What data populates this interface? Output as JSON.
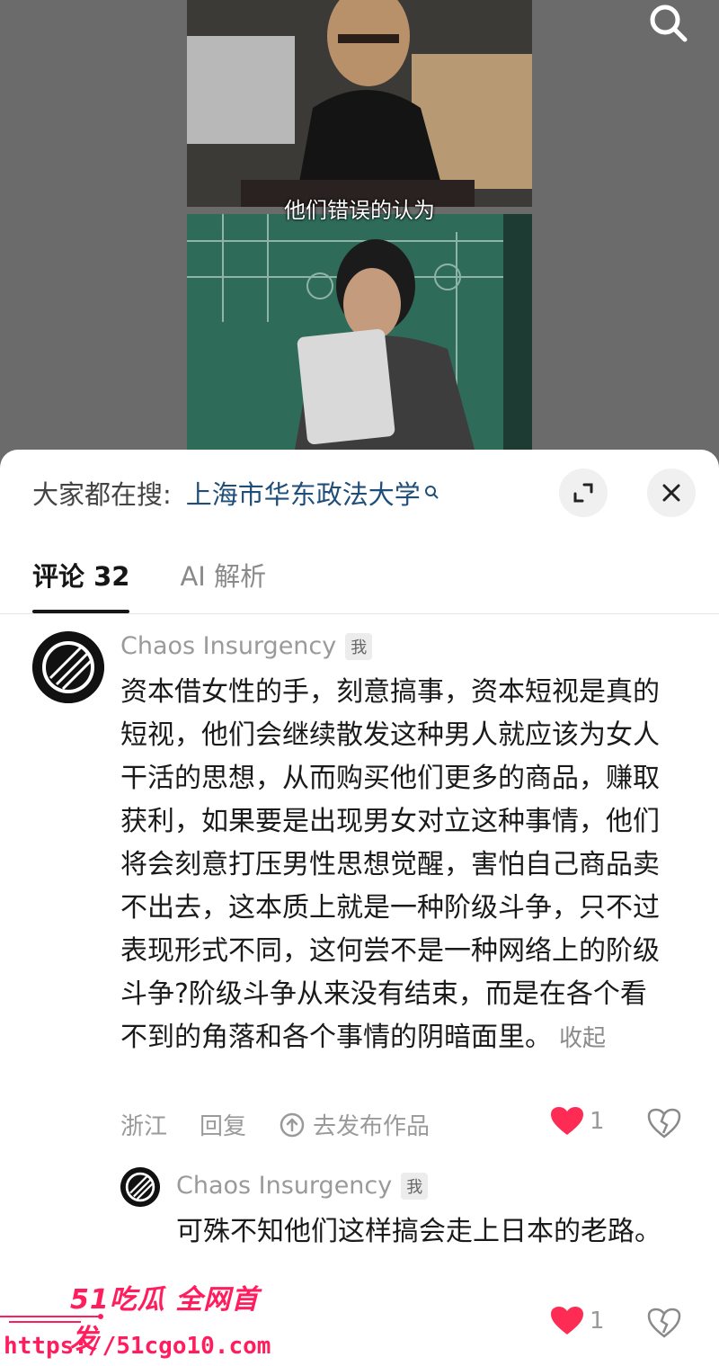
{
  "video": {
    "subtitle": "他们错误的认为"
  },
  "hot_search": {
    "label": "大家都在搜:",
    "term": "上海市华东政法大学"
  },
  "tabs": [
    {
      "label": "评论 32"
    },
    {
      "label": "AI 解析"
    }
  ],
  "comments": [
    {
      "author": "Chaos Insurgency",
      "badge": "我",
      "text": "资本借女性的手，刻意搞事，资本短视是真的短视，他们会继续散发这种男人就应该为女人干活的思想，从而购买他们更多的商品，赚取获利，如果要是出现男女对立这种事情，他们将会刻意打压男性思想觉醒，害怕自己商品卖不出去，这本质上就是一种阶级斗争，只不过表现形式不同，这何尝不是一种网络上的阶级斗争?阶级斗争从来没有结束，而是在各个看不到的角落和各个事情的阴暗面里。",
      "collapse": "收起",
      "location": "浙江",
      "reply": "回复",
      "publish": "去发布作品",
      "likes": "1"
    },
    {
      "author": "Chaos Insurgency",
      "badge": "我",
      "text": "可殊不知他们这样搞会走上日本的老路。",
      "likes": "1"
    }
  ],
  "watermark": {
    "brand": "51吃瓜 全网首发",
    "url": "https://51cgo10.com"
  },
  "colors": {
    "like_red": "#fe2c55",
    "link_blue": "#1f4e79",
    "watermark": "#ff1d5e"
  },
  "icons": [
    "search-icon",
    "expand-icon",
    "close-icon",
    "share-icon",
    "heart-icon",
    "broken-heart-icon",
    "chaos-insurgency-logo"
  ]
}
